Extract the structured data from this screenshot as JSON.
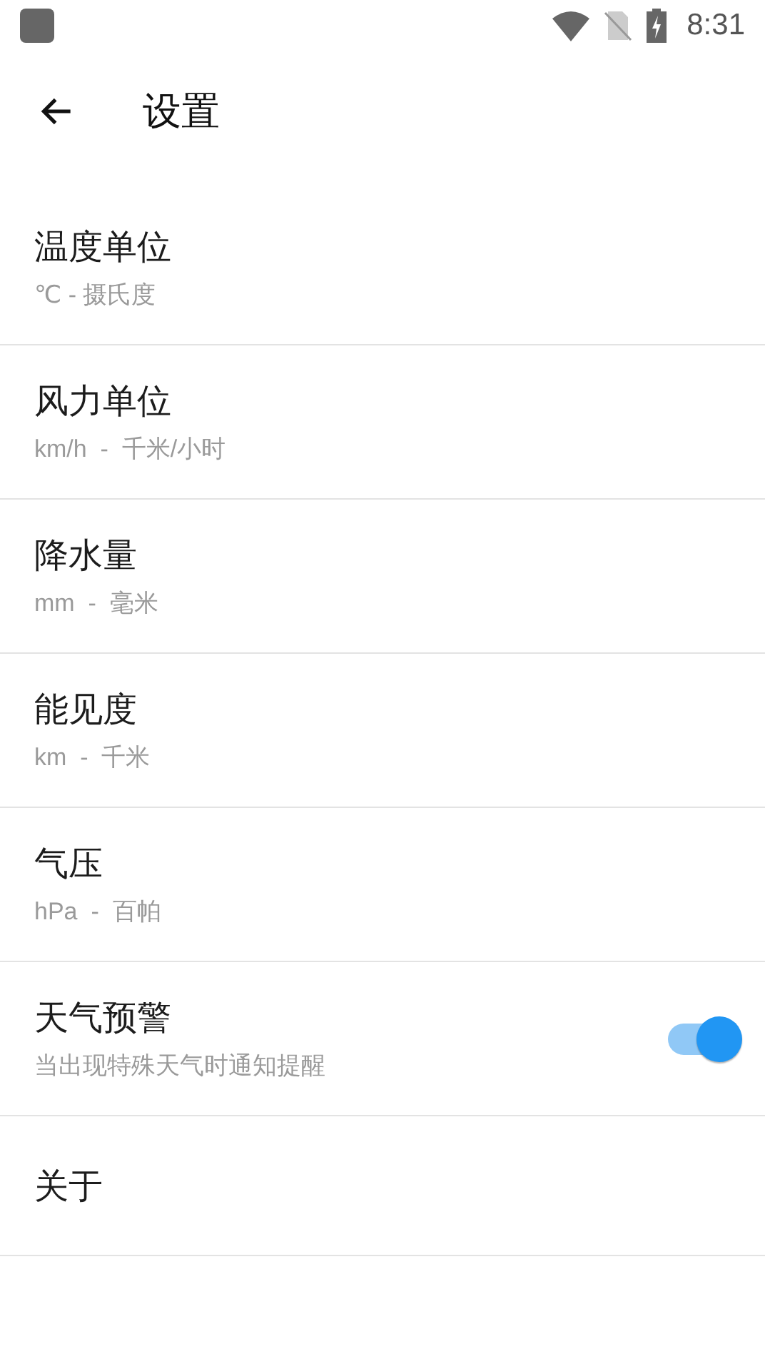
{
  "status_bar": {
    "time": "8:31"
  },
  "toolbar": {
    "title": "设置"
  },
  "items": [
    {
      "kind": "plain",
      "title": "温度单位",
      "subtitle": "℃ - 摄氏度"
    },
    {
      "kind": "plain",
      "title": "风力单位",
      "subtitle": "km/h  -  千米/小时"
    },
    {
      "kind": "plain",
      "title": "降水量",
      "subtitle": "mm  -  毫米"
    },
    {
      "kind": "plain",
      "title": "能见度",
      "subtitle": "km  -  千米"
    },
    {
      "kind": "plain",
      "title": "气压",
      "subtitle": "hPa  -  百帕"
    },
    {
      "kind": "switch",
      "title": "天气预警",
      "subtitle": "当出现特殊天气时通知提醒",
      "on": true
    },
    {
      "kind": "plain",
      "title": "关于"
    }
  ]
}
